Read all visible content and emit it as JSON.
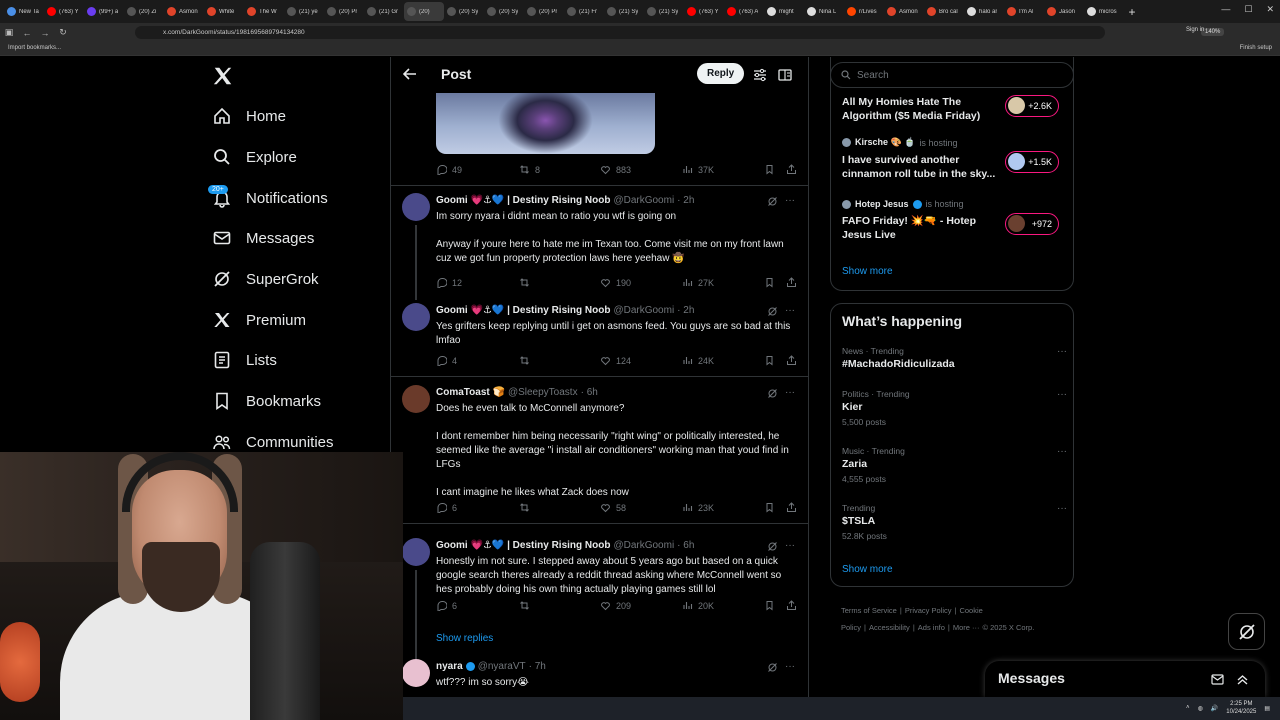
{
  "browser": {
    "tabs": [
      {
        "label": "New Ta",
        "color": "#4a8fe7",
        "active": false
      },
      {
        "label": "(763) Y",
        "color": "#ff0000",
        "active": false
      },
      {
        "label": "(99+) a",
        "color": "#6a3df0",
        "active": false
      },
      {
        "label": "(20) Zi",
        "color": "#555555",
        "active": false
      },
      {
        "label": "Asmon",
        "color": "#e0442a",
        "active": false
      },
      {
        "label": "White",
        "color": "#e0442a",
        "active": false
      },
      {
        "label": "The W",
        "color": "#e0442a",
        "active": false
      },
      {
        "label": "(21) ye",
        "color": "#555555",
        "active": false
      },
      {
        "label": "(20) Pr",
        "color": "#555555",
        "active": false
      },
      {
        "label": "(21) Gr",
        "color": "#555555",
        "active": false
      },
      {
        "label": "(20)",
        "color": "#555555",
        "active": true
      },
      {
        "label": "(20) Sy",
        "color": "#555555",
        "active": false
      },
      {
        "label": "(20) Sy",
        "color": "#555555",
        "active": false
      },
      {
        "label": "(20) Pr",
        "color": "#555555",
        "active": false
      },
      {
        "label": "(21) Fr",
        "color": "#555555",
        "active": false
      },
      {
        "label": "(21) Sy",
        "color": "#555555",
        "active": false
      },
      {
        "label": "(21) Sy",
        "color": "#555555",
        "active": false
      },
      {
        "label": "(763) Y",
        "color": "#ff0000",
        "active": false
      },
      {
        "label": "(763) A",
        "color": "#ff0000",
        "active": false
      },
      {
        "label": "might",
        "color": "#dddddd",
        "active": false
      },
      {
        "label": "Nina L",
        "color": "#dddddd",
        "active": false
      },
      {
        "label": "r/Lives",
        "color": "#ff4500",
        "active": false
      },
      {
        "label": "Asmon",
        "color": "#e0442a",
        "active": false
      },
      {
        "label": "Bro cal",
        "color": "#e0442a",
        "active": false
      },
      {
        "label": "halo ar",
        "color": "#dddddd",
        "active": false
      },
      {
        "label": "I'm Al",
        "color": "#e0442a",
        "active": false
      },
      {
        "label": "Jason",
        "color": "#e0442a",
        "active": false
      },
      {
        "label": "micros",
        "color": "#dddddd",
        "active": false
      }
    ],
    "new_tab": "+",
    "url": "x.com/DarkGoomi/status/1981695689794134280",
    "zoom": "140%",
    "sign_in": "Sign in",
    "bookmarks_import": "Import bookmarks...",
    "finish_setup": "Finish setup"
  },
  "sidebar": {
    "items": [
      {
        "label": "Home",
        "icon": "home-icon"
      },
      {
        "label": "Explore",
        "icon": "search-icon"
      },
      {
        "label": "Notifications",
        "icon": "bell-icon"
      },
      {
        "label": "Messages",
        "icon": "mail-icon"
      },
      {
        "label": "SuperGrok",
        "icon": "grok-icon"
      },
      {
        "label": "Premium",
        "icon": "x-logo-icon"
      },
      {
        "label": "Lists",
        "icon": "list-icon"
      },
      {
        "label": "Bookmarks",
        "icon": "bookmark-icon"
      },
      {
        "label": "Communities",
        "icon": "people-icon"
      }
    ],
    "notif_badge": "20+"
  },
  "header": {
    "title": "Post",
    "reply_label": "Reply"
  },
  "top_post": {
    "replies": "49",
    "reposts": "8",
    "likes": "883",
    "views": "37K"
  },
  "tweets": [
    {
      "name": "Goomi 💗⚓💙 | Destiny Rising Noob",
      "handle": "@DarkGoomi",
      "time": "· 2h",
      "text": "Im sorry nyara i didnt mean to ratio you wtf is going on\n\nAnyway if youre here to hate me im Texan too. Come visit me on my front lawn cuz we got fun property protection laws here yeehaw 🤠",
      "replies": "12",
      "reposts": "",
      "likes": "190",
      "views": "27K",
      "avatar_color": "#4a4a8a"
    },
    {
      "name": "Goomi 💗⚓💙 | Destiny Rising Noob",
      "handle": "@DarkGoomi",
      "time": "· 2h",
      "text": "Yes grifters keep replying until i get on asmons feed. You guys are so bad at this lmfao",
      "replies": "4",
      "reposts": "",
      "likes": "124",
      "views": "24K",
      "avatar_color": "#4a4a8a"
    },
    {
      "name": "ComaToast 🍞",
      "handle": "@SleepyToastx",
      "time": "· 6h",
      "text": "Does he even talk to McConnell anymore?\n\nI dont remember him being necessarily \"right wing\" or politically interested, he seemed like the average \"i install air conditioners\" working man that youd find in LFGs\n\nI cant imagine he likes what Zack does now",
      "replies": "6",
      "reposts": "",
      "likes": "58",
      "views": "23K",
      "avatar_color": "#6a3a2a"
    },
    {
      "name": "Goomi 💗⚓💙 | Destiny Rising Noob",
      "handle": "@DarkGoomi",
      "time": "· 6h",
      "text": "Honestly im not sure. I stepped away about 5 years ago but based on a quick google search theres already a reddit thread asking where McConnell went so hes probably doing his own thing actually playing games still lol",
      "replies": "6",
      "reposts": "",
      "likes": "209",
      "views": "20K",
      "avatar_color": "#4a4a8a"
    },
    {
      "name": "nyara",
      "handle": "@nyaraVT",
      "time": "· 7h",
      "text": "wtf??? im so sorry😭",
      "replies": "",
      "reposts": "",
      "likes": "",
      "views": "",
      "avatar_color": "#e8c0d0"
    }
  ],
  "show_replies": "Show replies",
  "right": {
    "search_placeholder": "Search",
    "spaces": [
      {
        "host": "",
        "host_suffix": "",
        "title": "All My Homies Hate The Algorithm ($5 Media Friday)",
        "count": "+2.6K",
        "pill_avatar": "#d8c8a8"
      },
      {
        "host": "Kirsche 🎨 🍵",
        "host_suffix": "is hosting",
        "title": "I have survived another cinnamon roll tube in the sky...",
        "count": "+1.5K",
        "pill_avatar": "#b0c8f0"
      },
      {
        "host": "Hotep Jesus",
        "host_suffix": "is hosting",
        "title": "FAFO Friday! 💥🔫 - Hotep Jesus Live",
        "count": "+972",
        "pill_avatar": "#6a4030"
      }
    ],
    "show_more_1": "Show more",
    "happening_title": "What’s happening",
    "trends": [
      {
        "category": "News · Trending",
        "name": "#MachadoRidiculizada",
        "posts": ""
      },
      {
        "category": "Politics · Trending",
        "name": "Kier",
        "posts": "5,500 posts"
      },
      {
        "category": "Music · Trending",
        "name": "Zaria",
        "posts": "4,555 posts"
      },
      {
        "category": "Trending",
        "name": "$TSLA",
        "posts": "52.8K posts"
      }
    ],
    "show_more_2": "Show more",
    "footer": [
      "Terms of Service",
      "|",
      "Privacy Policy",
      "|",
      "Cookie Policy",
      "|",
      "Accessibility",
      "|",
      "Ads info",
      "|",
      "More ···",
      "© 2025 X Corp."
    ]
  },
  "messages_drawer": {
    "title": "Messages"
  },
  "taskbar": {
    "time": "2:25 PM",
    "date": "10/24/2025"
  }
}
